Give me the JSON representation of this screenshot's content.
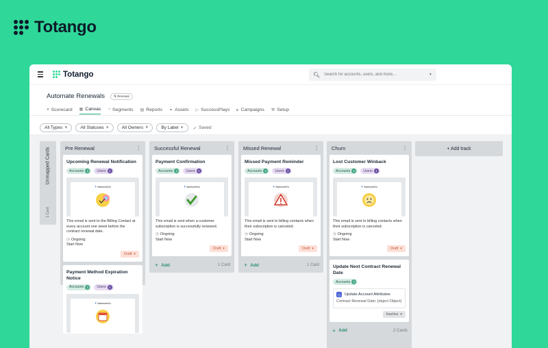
{
  "brand": {
    "name": "Totango"
  },
  "topbar": {
    "logo": "Totango",
    "search": {
      "placeholder": "Search for accounts, users, and more..."
    }
  },
  "page": {
    "title": "Automate Renewals",
    "badge": "Renewal"
  },
  "tabs": [
    {
      "label": "Scorecard",
      "icon": "gauge-icon"
    },
    {
      "label": "Canvas",
      "icon": "canvas-icon",
      "active": true
    },
    {
      "label": "Segments",
      "icon": "segments-icon"
    },
    {
      "label": "Reports",
      "icon": "chart-icon"
    },
    {
      "label": "Assets",
      "icon": "link-icon"
    },
    {
      "label": "SuccessPlays",
      "icon": "play-icon"
    },
    {
      "label": "Campaigns",
      "icon": "megaphone-icon"
    },
    {
      "label": "Setup",
      "icon": "wrench-icon"
    }
  ],
  "filters": {
    "all_types": "All Types",
    "all_statuses": "All Statuses",
    "all_owners": "All Owners",
    "by_label": "By Label",
    "saved": "Saved"
  },
  "unmapped": {
    "title": "Unmapped Cards",
    "count": "1 Card"
  },
  "columns": {
    "pre_renewal": {
      "title": "Pre Renewal",
      "cards": [
        {
          "title": "Upcoming Renewal Notification",
          "accounts_label": "Accounts",
          "accounts_count": "1",
          "users_label": "Users",
          "users_count": "1",
          "thumb_brand": "AwesomeCo",
          "description": "This email is sent to the Billing Contact at every account one week before the contract renewal date.",
          "schedule": "Ongoing",
          "start": "Start Now",
          "status": "Draft"
        },
        {
          "title": "Payment Method Expiration Notice",
          "accounts_label": "Accounts",
          "accounts_count": "1",
          "users_label": "Users",
          "users_count": "1",
          "thumb_brand": "AwesomeCo"
        }
      ]
    },
    "successful_renewal": {
      "title": "Successful Renewal",
      "add": "Add",
      "count": "1 Card",
      "card": {
        "title": "Payment Confirmation",
        "accounts_label": "Accounts",
        "accounts_count": "1",
        "users_label": "Users",
        "users_count": "1",
        "thumb_brand": "AwesomeCo",
        "description": "This email is sent when a customer subscription is successfully renewed.",
        "schedule": "Ongoing",
        "start": "Start Now",
        "status": "Draft"
      }
    },
    "missed_renewal": {
      "title": "Missed Renewal",
      "add": "Add",
      "count": "1 Card",
      "card": {
        "title": "Missed Payment Reminder",
        "accounts_label": "Accounts",
        "accounts_count": "1",
        "users_label": "Users",
        "users_count": "1",
        "thumb_brand": "AwesomeCo",
        "description": "This email is sent to billing contacts when their subscription is canceled.",
        "schedule": "Ongoing",
        "start": "Start Now",
        "status": "Draft"
      }
    },
    "churn": {
      "title": "Churn",
      "add": "Add",
      "count": "2 Cards",
      "card1": {
        "title": "Lost Customer Winback",
        "accounts_label": "Accounts",
        "accounts_count": "1",
        "users_label": "Users",
        "users_count": "1",
        "thumb_brand": "AwesomeCo",
        "description": "This email is sent to billing contacts when their subscription is canceled.",
        "schedule": "Ongoing",
        "start": "Start Now",
        "status": "Draft"
      },
      "card2": {
        "title": "Update Next Contract Renewal Date",
        "accounts_label": "Accounts",
        "accounts_count": "1",
        "action_title": "Update Account Attributes",
        "action_detail": "Contract Renewal Date: [object Object]",
        "status": "Inactive"
      }
    }
  },
  "add_track": "+ Add track",
  "colors": {
    "background": "#2fd898",
    "accent": "#1aa879",
    "draft": "#c5583b"
  }
}
